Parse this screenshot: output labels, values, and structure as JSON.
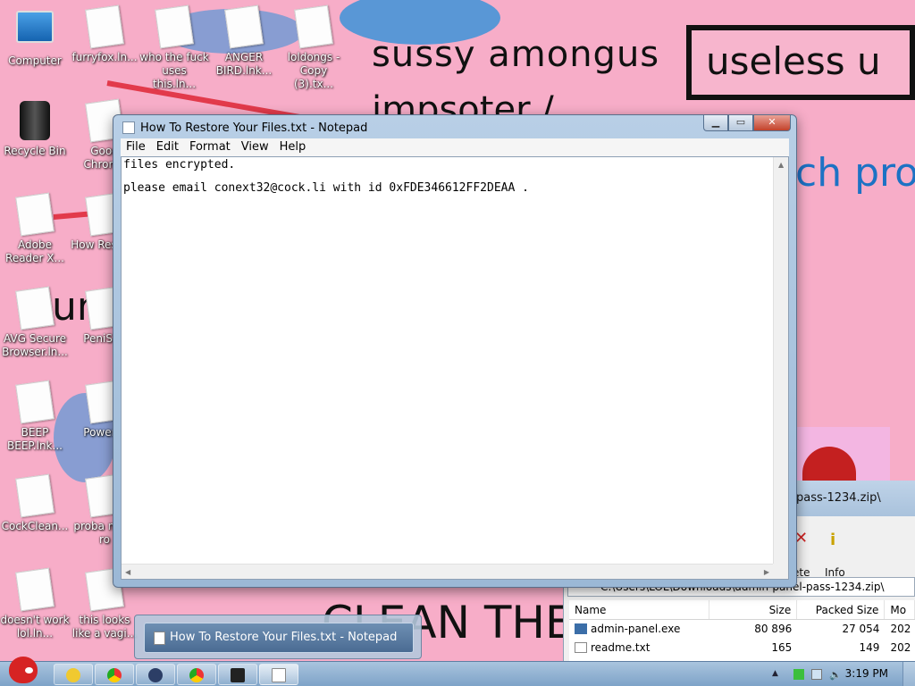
{
  "wallpaper": {
    "texts": {
      "sussy": "sussy amongus",
      "impsoter": "impsoter /",
      "useless": "useless u",
      "chpro": "ch pro",
      "clean": "CLEAN THE",
      "num": "un"
    }
  },
  "desktop_icons": [
    {
      "id": "computer",
      "label": "Computer",
      "icon": "computer-icon"
    },
    {
      "id": "furryfox",
      "label": "furryfox.ln...",
      "icon": "document-icon"
    },
    {
      "id": "who",
      "label": "who the fuck uses this.ln...",
      "icon": "document-icon"
    },
    {
      "id": "anger",
      "label": "ANGER BIRD.lnk...",
      "icon": "document-icon"
    },
    {
      "id": "loldongs",
      "label": "loldongs - Copy (3).tx...",
      "icon": "document-icon"
    },
    {
      "id": "recycle",
      "label": "Recycle Bin",
      "icon": "recycle-bin-icon"
    },
    {
      "id": "chrome",
      "label": "Goog Chrome",
      "icon": "document-icon"
    },
    {
      "id": "adobe",
      "label": "Adobe Reader X...",
      "icon": "document-icon"
    },
    {
      "id": "howto",
      "label": "How Restore",
      "icon": "document-icon"
    },
    {
      "id": "avg",
      "label": "AVG Secure Browser.ln...",
      "icon": "document-icon"
    },
    {
      "id": "penis",
      "label": "PeniS.ln",
      "icon": "document-icon"
    },
    {
      "id": "beep",
      "label": "BEEP BEEP.lnk...",
      "icon": "document-icon"
    },
    {
      "id": "power",
      "label": "PowerIS",
      "icon": "document-icon"
    },
    {
      "id": "cockclean",
      "label": "CockClean...",
      "icon": "document-icon"
    },
    {
      "id": "proba",
      "label": "proba not a ro",
      "icon": "document-icon"
    },
    {
      "id": "doesnt",
      "label": "doesn't work lol.ln...",
      "icon": "document-icon"
    },
    {
      "id": "thislooks",
      "label": "this looks like a vagi...",
      "icon": "document-icon"
    }
  ],
  "notepad": {
    "title": "How To Restore Your Files.txt - Notepad",
    "menu": [
      "File",
      "Edit",
      "Format",
      "View",
      "Help"
    ],
    "line1": "files encrypted.",
    "line2": "please email conext32@cock.li with id 0xFDE346612FF2DEAA ."
  },
  "zip": {
    "title": "pass-1234.zip\\",
    "address": "C:\\Users\\LOL\\Downloads\\admin-panel-pass-1234.zip\\",
    "tools": [
      {
        "label": "ete"
      },
      {
        "label": "Info"
      }
    ],
    "columns": [
      "Name",
      "Size",
      "Packed Size",
      "Mo"
    ],
    "rows": [
      {
        "name": "admin-panel.exe",
        "size": "80 896",
        "packed": "27 054",
        "mod": "202"
      },
      {
        "name": "readme.txt",
        "size": "165",
        "packed": "149",
        "mod": "202"
      }
    ]
  },
  "preview": {
    "label": "How To Restore Your Files.txt - Notepad"
  },
  "taskbar": {
    "clock": "3:19 PM",
    "apps": [
      "explorer",
      "chrome",
      "eclipse",
      "chrome-2",
      "7zip",
      "notepad"
    ]
  }
}
